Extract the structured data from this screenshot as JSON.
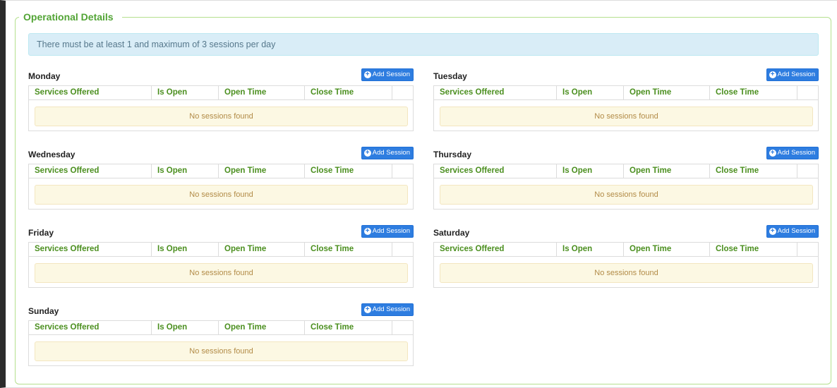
{
  "section": {
    "title": "Operational Details",
    "alert": "There must be at least 1 and maximum of 3 sessions per day"
  },
  "columns": [
    "Services Offered",
    "Is Open",
    "Open Time",
    "Close Time"
  ],
  "add_button_label": "Add Session",
  "empty_message": "No sessions found",
  "days": [
    {
      "name": "Monday"
    },
    {
      "name": "Tuesday"
    },
    {
      "name": "Wednesday"
    },
    {
      "name": "Thursday"
    },
    {
      "name": "Friday"
    },
    {
      "name": "Saturday"
    },
    {
      "name": "Sunday"
    }
  ],
  "colors": {
    "accent_green": "#52a435",
    "button_blue": "#2e7de0",
    "alert_bg": "#d9edf7",
    "empty_bg": "#fcf8e3"
  }
}
